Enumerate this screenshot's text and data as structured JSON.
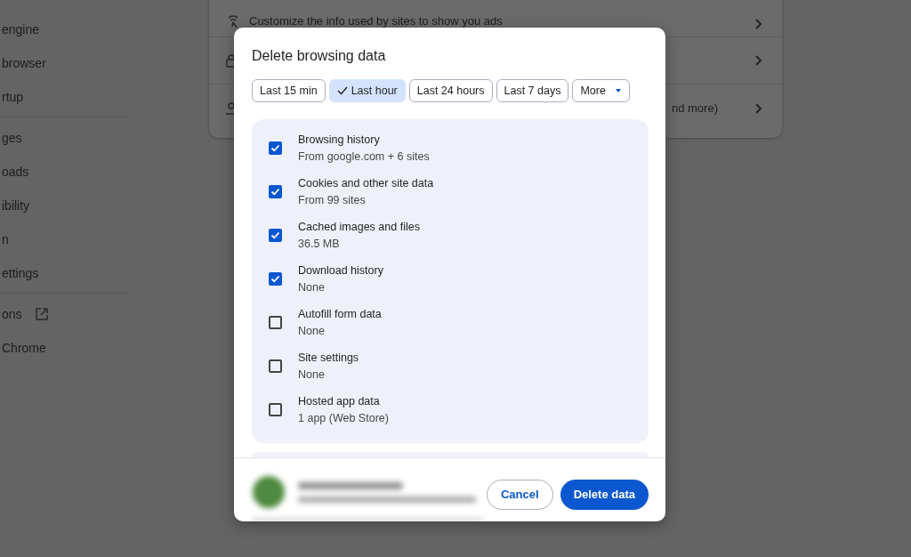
{
  "sidebar": {
    "sections": [
      {
        "items": [
          {
            "label": "engine",
            "external": false
          },
          {
            "label": "browser",
            "external": false
          },
          {
            "label": "rtup",
            "external": false
          }
        ]
      },
      {
        "items": [
          {
            "label": "ges",
            "external": false
          },
          {
            "label": "oads",
            "external": false
          },
          {
            "label": "ibility",
            "external": false
          },
          {
            "label": "n",
            "external": false
          },
          {
            "label": "ettings",
            "external": false
          }
        ]
      },
      {
        "items": [
          {
            "label": "ons",
            "external": true
          },
          {
            "label": "Chrome",
            "external": false
          }
        ]
      }
    ]
  },
  "background_card": {
    "rows": [
      {
        "kind": "ads",
        "text": "Customize the info used by sites to show you ads"
      },
      {
        "kind": "lock"
      },
      {
        "kind": "person",
        "text": "nd more)"
      }
    ]
  },
  "dialog": {
    "title": "Delete browsing data",
    "time_ranges": [
      {
        "label": "Last 15 min",
        "selected": false
      },
      {
        "label": "Last hour",
        "selected": true
      },
      {
        "label": "Last 24 hours",
        "selected": false
      },
      {
        "label": "Last 7 days",
        "selected": false
      }
    ],
    "more_button": {
      "label": "More"
    },
    "options": [
      {
        "label": "Browsing history",
        "detail": "From google.com + 6 sites",
        "checked": true
      },
      {
        "label": "Cookies and other site data",
        "detail": "From 99 sites",
        "checked": true
      },
      {
        "label": "Cached images and files",
        "detail": "36.5 MB",
        "checked": true
      },
      {
        "label": "Download history",
        "detail": "None",
        "checked": true
      },
      {
        "label": "Autofill form data",
        "detail": "None",
        "checked": false
      },
      {
        "label": "Site settings",
        "detail": "None",
        "checked": false
      },
      {
        "label": "Hosted app data",
        "detail": "1 app (Web Store)",
        "checked": false
      }
    ],
    "buttons": {
      "cancel": "Cancel",
      "confirm": "Delete data"
    }
  }
}
